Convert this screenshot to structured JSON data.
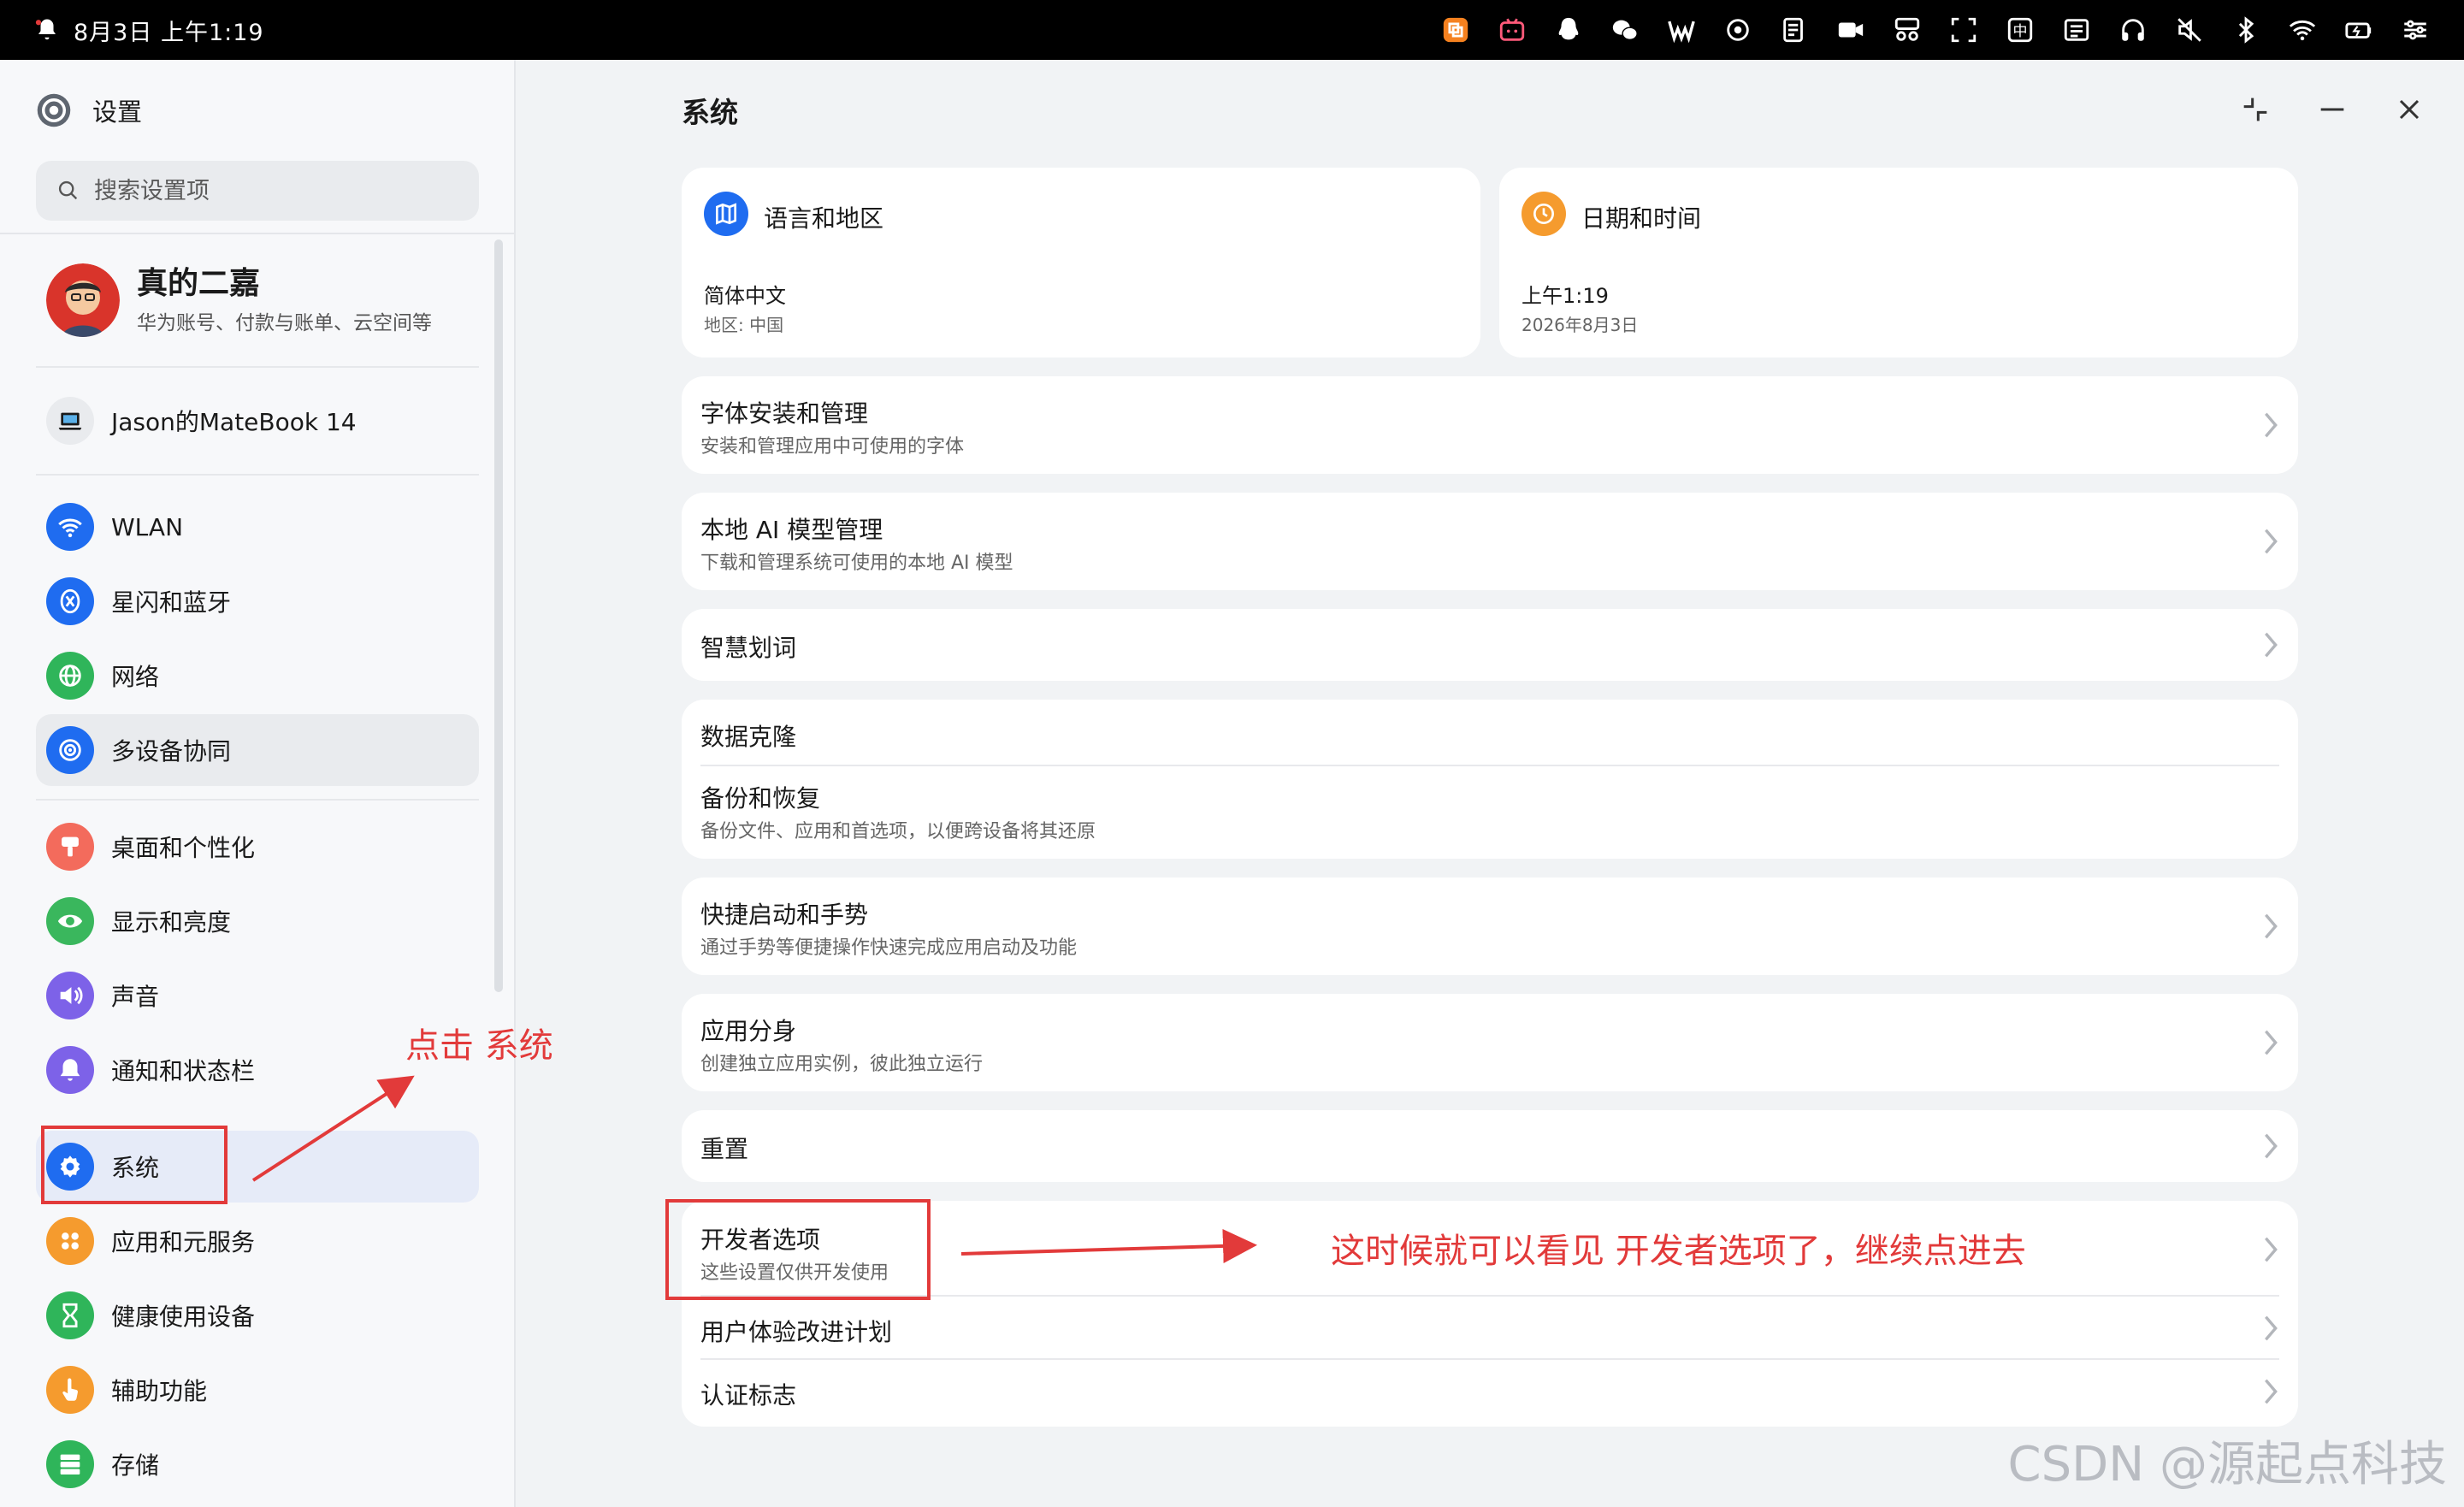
{
  "statusbar": {
    "datetime": "8月3日 上午1:19",
    "tray_icons": [
      "wps-office-icon",
      "bilibili-icon",
      "qq-icon",
      "wechat-icon",
      "wps-icon",
      "settings-sync-icon",
      "notes-icon",
      "video-icon",
      "scissors-icon",
      "screenshot-icon",
      "input-method-icon",
      "task-list-icon",
      "headphones-icon",
      "mute-icon",
      "bluetooth-icon",
      "wifi-icon",
      "battery-icon",
      "controls-icon"
    ]
  },
  "app": {
    "title": "设置"
  },
  "search": {
    "placeholder": "搜索设置项"
  },
  "account": {
    "name": "真的二嘉",
    "desc": "华为账号、付款与账单、云空间等"
  },
  "device": {
    "label": "Jason的MateBook 14"
  },
  "sidebar": {
    "items": [
      {
        "label": "WLAN",
        "icon": "wifi-icon",
        "color": "#1f6cf0"
      },
      {
        "label": "星闪和蓝牙",
        "icon": "bluetooth-icon",
        "color": "#1f6cf0"
      },
      {
        "label": "网络",
        "icon": "globe-icon",
        "color": "#2fb55a"
      },
      {
        "label": "多设备协同",
        "icon": "multi-device-icon",
        "color": "#1f6cf0"
      },
      {
        "label": "桌面和个性化",
        "icon": "brush-icon",
        "color": "#f36b5c"
      },
      {
        "label": "显示和亮度",
        "icon": "eye-icon",
        "color": "#3ab75d"
      },
      {
        "label": "声音",
        "icon": "speaker-icon",
        "color": "#7d62e8"
      },
      {
        "label": "通知和状态栏",
        "icon": "bell-icon",
        "color": "#7d62e8"
      },
      {
        "label": "系统",
        "icon": "gear-icon",
        "color": "#1f6cf0"
      },
      {
        "label": "应用和元服务",
        "icon": "apps-icon",
        "color": "#f59b2e"
      },
      {
        "label": "健康使用设备",
        "icon": "hourglass-icon",
        "color": "#2fb55a"
      },
      {
        "label": "辅助功能",
        "icon": "hand-icon",
        "color": "#f59b2e"
      },
      {
        "label": "存储",
        "icon": "storage-icon",
        "color": "#2fb55a"
      }
    ]
  },
  "main": {
    "title": "系统",
    "lang_card": {
      "title": "语言和地区",
      "value": "简体中文",
      "sub": "地区: 中国"
    },
    "date_card": {
      "title": "日期和时间",
      "value": "上午1:19",
      "sub": "2026年8月3日"
    },
    "fonts": {
      "title": "字体安装和管理",
      "sub": "安装和管理应用中可使用的字体"
    },
    "ai_model": {
      "title": "本地 AI 模型管理",
      "sub": "下载和管理系统可使用的本地 AI 模型"
    },
    "smart_words": {
      "title": "智慧划词"
    },
    "data_clone": {
      "title": "数据克隆"
    },
    "backup": {
      "title": "备份和恢复",
      "sub": "备份文件、应用和首选项，以便跨设备将其还原"
    },
    "gestures": {
      "title": "快捷启动和手势",
      "sub": "通过手势等便捷操作快速完成应用启动及功能"
    },
    "app_twin": {
      "title": "应用分身",
      "sub": "创建独立应用实例，彼此独立运行"
    },
    "reset": {
      "title": "重置"
    },
    "developer": {
      "title": "开发者选项",
      "sub": "这些设置仅供开发使用"
    },
    "ux_plan": {
      "title": "用户体验改进计划"
    },
    "cert": {
      "title": "认证标志"
    }
  },
  "annotations": {
    "click_system": "点击 系统",
    "see_developer": "这时候就可以看见 开发者选项了，继续点进去",
    "color": "#e23a3a"
  },
  "watermark": "CSDN @源起点科技"
}
